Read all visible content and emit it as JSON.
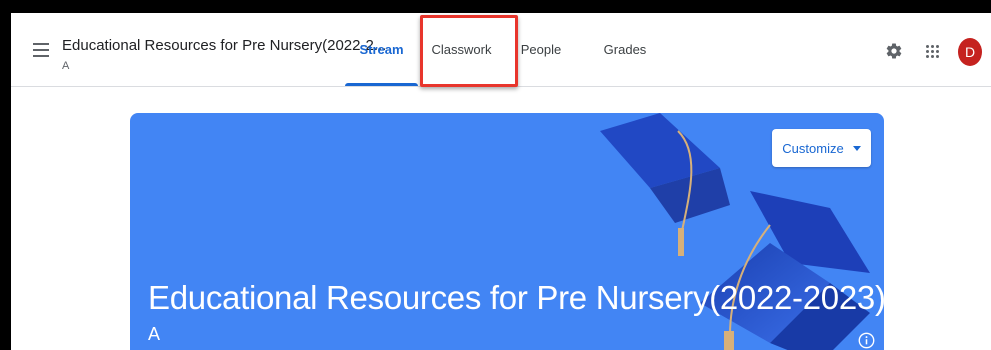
{
  "header": {
    "class_title": "Educational Resources for Pre Nursery(2022-2...",
    "class_section": "A",
    "avatar_letter": "D"
  },
  "tabs": [
    {
      "label": "Stream",
      "active": true
    },
    {
      "label": "Classwork",
      "active": false,
      "highlighted": true
    },
    {
      "label": "People",
      "active": false
    },
    {
      "label": "Grades",
      "active": false
    }
  ],
  "banner": {
    "customize_label": "Customize",
    "title": "Educational Resources for Pre Nursery(2022-2023)",
    "section": "A"
  },
  "colors": {
    "accent": "#1967d2",
    "banner": "#4285f4",
    "highlight": "#e8352c",
    "avatar": "#c5221f"
  },
  "icons": [
    "menu-icon",
    "gear-icon",
    "apps-grid-icon",
    "chevron-down-icon",
    "info-icon",
    "graduation-cap-illustration"
  ]
}
